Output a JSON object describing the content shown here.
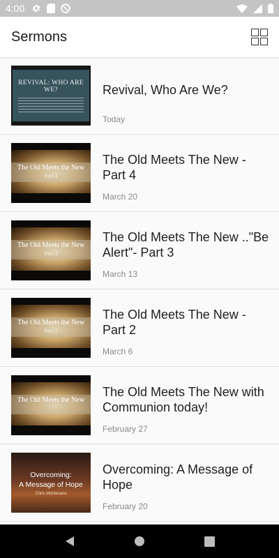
{
  "status_bar": {
    "time": "4:00",
    "left_icons": [
      "gear-icon",
      "sim-card-icon",
      "do-not-disturb-icon"
    ],
    "right_icons": [
      "wifi-icon",
      "signal-icon",
      "battery-icon"
    ]
  },
  "app_bar": {
    "title": "Sermons",
    "view_toggle_icon": "grid-view-icon"
  },
  "sermons": [
    {
      "title": "Revival, Who Are We?",
      "date": "Today",
      "thumbnail": {
        "style": "revival",
        "caption": "REVIVAL: WHO ARE WE?"
      }
    },
    {
      "title": "The Old Meets The New - Part 4",
      "date": "March 20",
      "thumbnail": {
        "style": "old-new",
        "caption": "The Old Meets the New",
        "subcaption": "Part 4"
      }
    },
    {
      "title": "The Old Meets The New ..\"Be Alert\"- Part 3",
      "date": "March 13",
      "thumbnail": {
        "style": "old-new",
        "caption": "The Old Meets the New",
        "subcaption": "Part 3"
      }
    },
    {
      "title": "The Old Meets The New - Part 2",
      "date": "March 6",
      "thumbnail": {
        "style": "old-new",
        "caption": "The Old Meets the New",
        "subcaption": "Part 2"
      }
    },
    {
      "title": "The Old Meets The New with Communion today!",
      "date": "February 27",
      "thumbnail": {
        "style": "old-new",
        "caption": "The Old Meets the New",
        "subcaption": ""
      }
    },
    {
      "title": "Overcoming: A Message of Hope",
      "date": "February 20",
      "thumbnail": {
        "style": "hope",
        "caption_line1": "Overcoming:",
        "caption_line2": "A Message of Hope",
        "byline": "Chris Montesano"
      }
    }
  ],
  "nav_bar": {
    "buttons": [
      "back-icon",
      "home-icon",
      "recents-icon"
    ]
  },
  "colors": {
    "status_bar": "#c4c4c4",
    "app_bar": "#ffffff",
    "list_background": "#fafafa",
    "divider": "#dedede",
    "title_text": "#1f1f1f",
    "date_text": "#8a8a8a",
    "nav_bar": "#000000"
  }
}
